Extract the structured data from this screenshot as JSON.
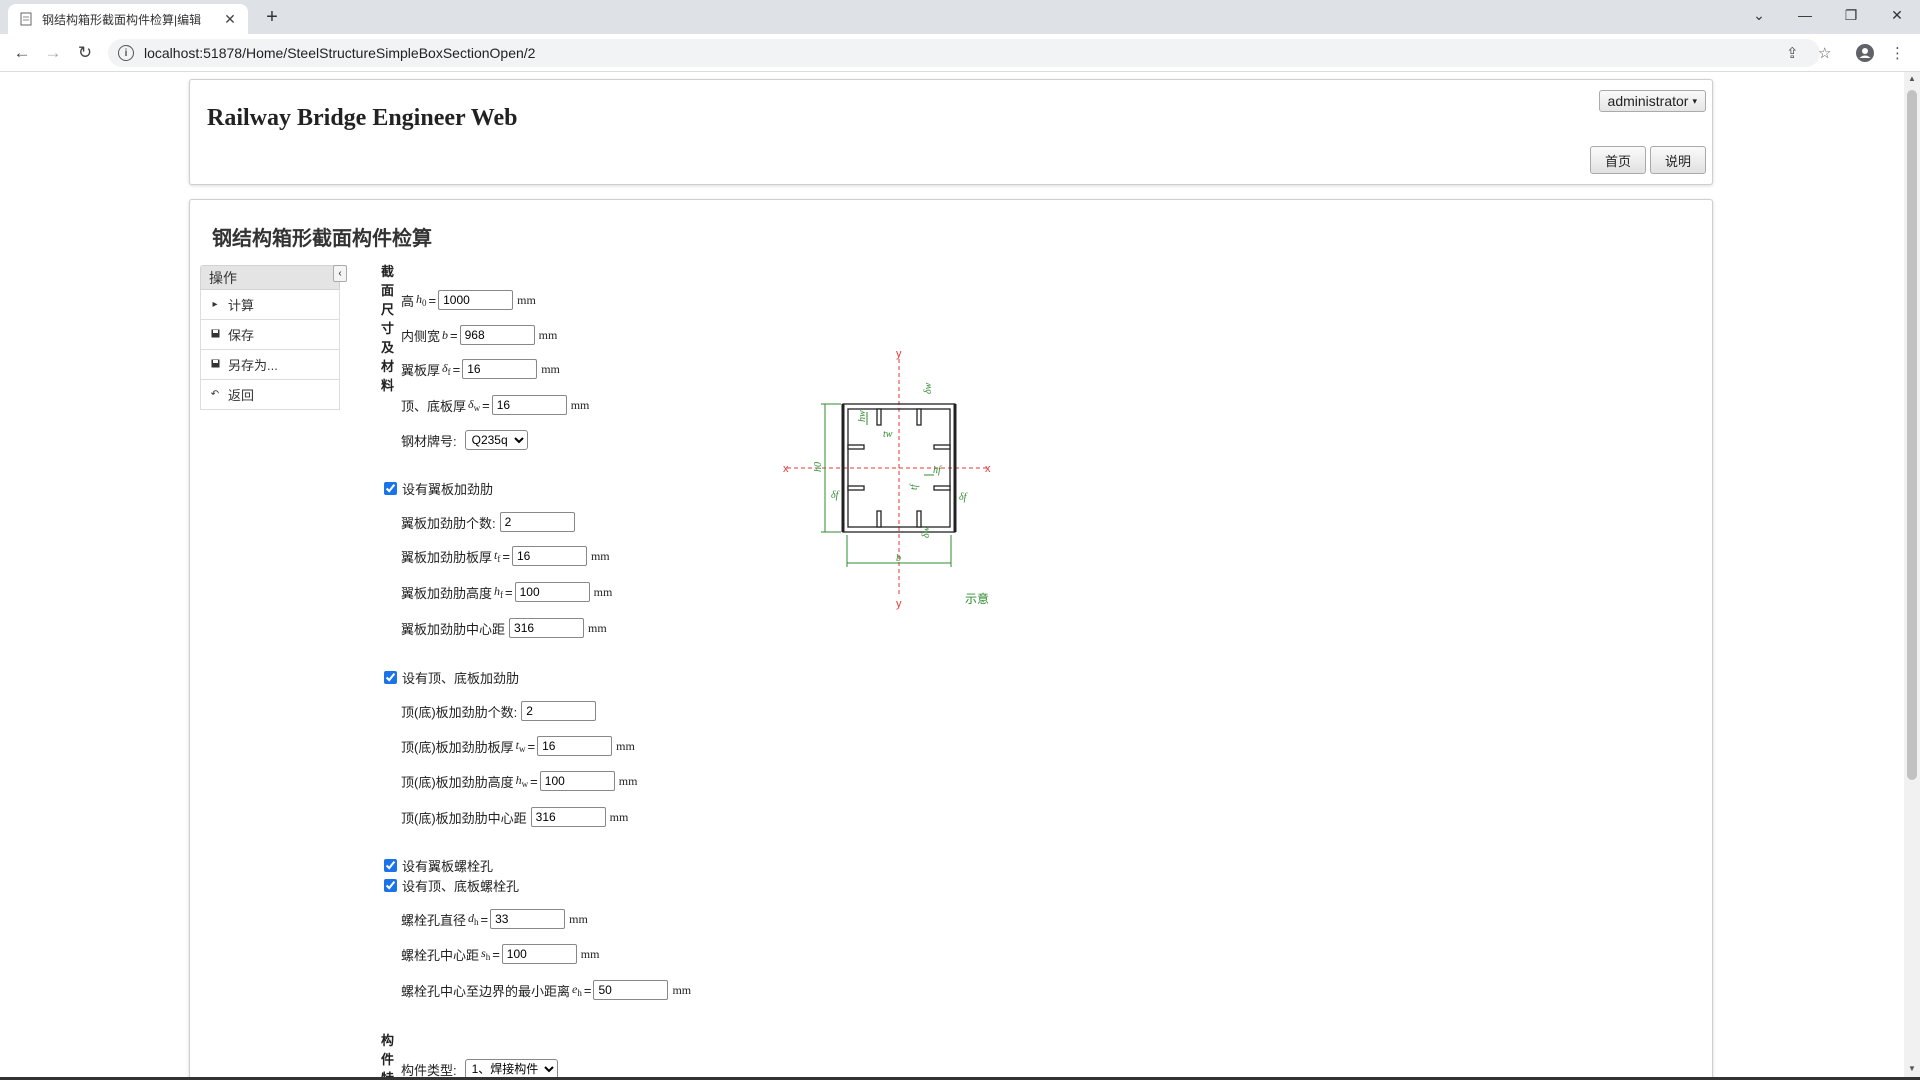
{
  "browser": {
    "tab_title": "钢结构箱形截面构件检算|编辑",
    "url": "localhost:51878/Home/SteelStructureSimpleBoxSectionOpen/2"
  },
  "header": {
    "site_title": "Railway Bridge Engineer Web",
    "user": "administrator",
    "nav": [
      "首页",
      "说明"
    ]
  },
  "page": {
    "title": "钢结构箱形截面构件检算"
  },
  "sidebar": {
    "header": "操作",
    "items": [
      {
        "label": "计算",
        "icon": "triangle-right-icon"
      },
      {
        "label": "保存",
        "icon": "save-icon"
      },
      {
        "label": "另存为...",
        "icon": "save-as-icon"
      },
      {
        "label": "返回",
        "icon": "undo-icon"
      }
    ]
  },
  "section1": {
    "title": "截面尺寸及材料",
    "height_label": "高",
    "height_sym": "h",
    "height_sub": "0",
    "height_value": "1000",
    "width_label": "内侧宽",
    "width_sym": "b",
    "width_value": "968",
    "flange_label": "翼板厚",
    "flange_sym": "δ",
    "flange_sub": "f",
    "flange_value": "16",
    "web_label": "顶、底板厚",
    "web_sym": "δ",
    "web_sub": "w",
    "web_value": "16",
    "steel_label": "钢材牌号:",
    "steel_value": "Q235q",
    "unit": "mm"
  },
  "flange_stiffener": {
    "checkbox_label": "设有翼板加劲肋",
    "checked": true,
    "count_label": "翼板加劲肋个数:",
    "count_value": "2",
    "thick_label": "翼板加劲肋板厚",
    "thick_sym": "t",
    "thick_sub": "f",
    "thick_value": "16",
    "height_label": "翼板加劲肋高度",
    "height_sym": "h",
    "height_sub": "f",
    "height_value": "100",
    "spacing_label": "翼板加劲肋中心距",
    "spacing_value": "316"
  },
  "web_stiffener": {
    "checkbox_label": "设有顶、底板加劲肋",
    "checked": true,
    "count_label": "顶(底)板加劲肋个数:",
    "count_value": "2",
    "thick_label": "顶(底)板加劲肋板厚",
    "thick_sym": "t",
    "thick_sub": "w",
    "thick_value": "16",
    "height_label": "顶(底)板加劲肋高度",
    "height_sym": "h",
    "height_sub": "w",
    "height_value": "100",
    "spacing_label": "顶(底)板加劲肋中心距",
    "spacing_value": "316"
  },
  "bolts": {
    "flange_hole_label": "设有翼板螺栓孔",
    "flange_hole_checked": true,
    "web_hole_label": "设有顶、底板螺栓孔",
    "web_hole_checked": true,
    "dia_label": "螺栓孔直径",
    "dia_sym": "d",
    "dia_sub": "h",
    "dia_value": "33",
    "spacing_label": "螺栓孔中心距",
    "spacing_sym": "s",
    "spacing_sub": "h",
    "spacing_value": "100",
    "edge_label": "螺栓孔中心至边界的最小距离",
    "edge_sym": "e",
    "edge_sub": "h",
    "edge_value": "50"
  },
  "member": {
    "title": "构件特性",
    "type_label": "构件类型:",
    "type_value": "1、焊接构件"
  },
  "diagram": {
    "caption": "示意",
    "axis_x": "x",
    "axis_y": "y",
    "label_b": "b",
    "label_h0": "h0",
    "label_df": "δf",
    "label_dw": "δw",
    "label_hw": "hw",
    "label_tw": "tw",
    "label_hf": "hf",
    "label_tf": "tf",
    "colors": {
      "axis": "#e53935",
      "dim": "#2e8b2e",
      "outline": "#222222"
    }
  }
}
